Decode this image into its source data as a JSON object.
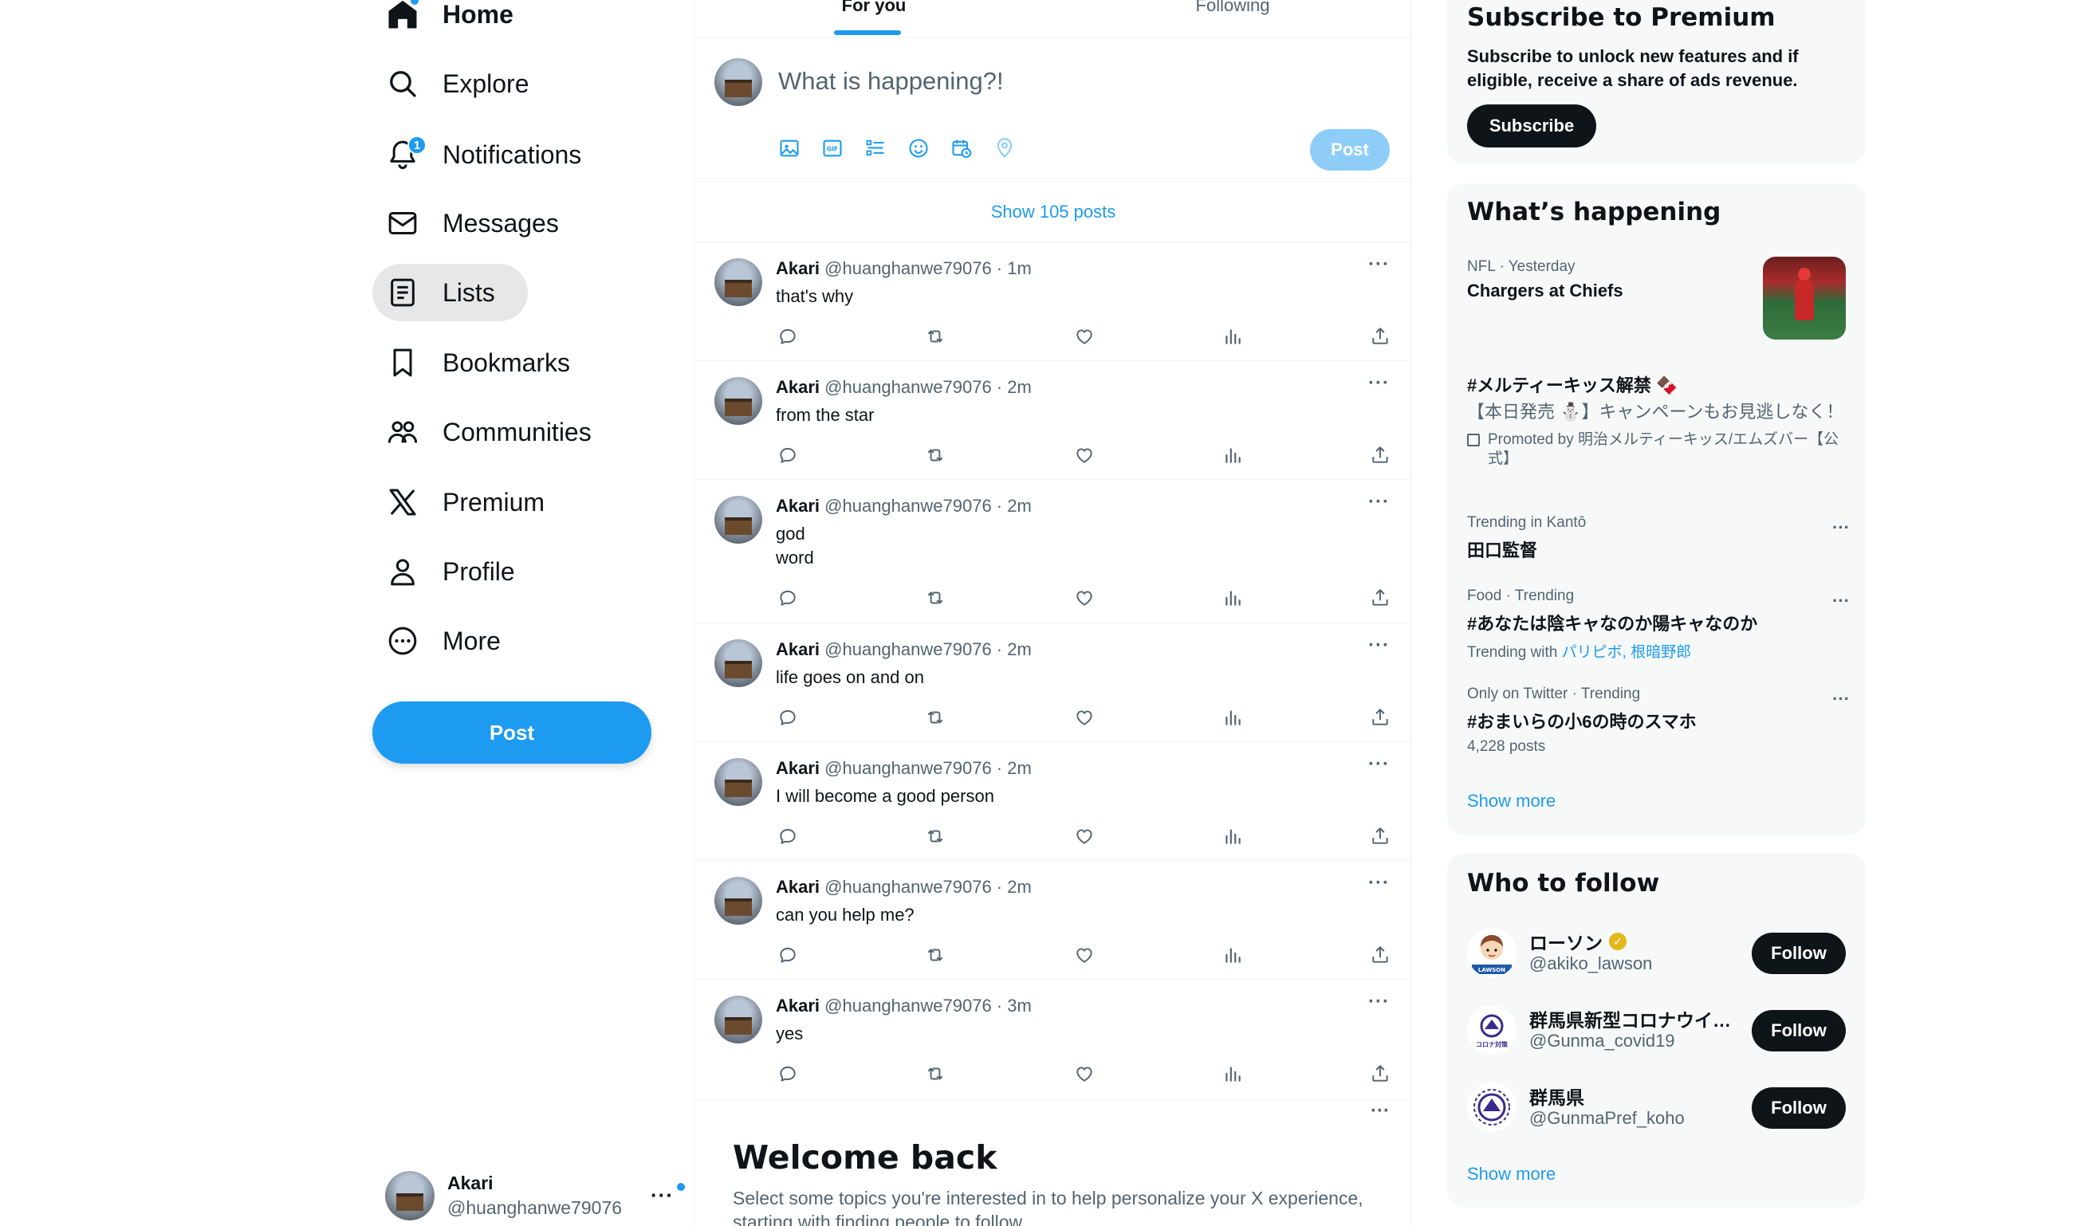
{
  "nav": {
    "items": [
      {
        "label": "Home",
        "icon": "home-icon"
      },
      {
        "label": "Explore",
        "icon": "search-icon"
      },
      {
        "label": "Notifications",
        "icon": "bell-icon",
        "badge": "1"
      },
      {
        "label": "Messages",
        "icon": "envelope-icon"
      },
      {
        "label": "Lists",
        "icon": "list-icon"
      },
      {
        "label": "Bookmarks",
        "icon": "bookmark-icon"
      },
      {
        "label": "Communities",
        "icon": "people-icon"
      },
      {
        "label": "Premium",
        "icon": "x-logo-icon"
      },
      {
        "label": "Profile",
        "icon": "person-icon"
      },
      {
        "label": "More",
        "icon": "more-circle-icon"
      }
    ],
    "post_label": "Post"
  },
  "account": {
    "name": "Akari",
    "handle": "@huanghanwe79076"
  },
  "tabs": [
    {
      "label": "For you"
    },
    {
      "label": "Following"
    }
  ],
  "composer": {
    "placeholder": "What is happening?!",
    "post_label": "Post"
  },
  "show_posts": "Show 105 posts",
  "tweets": [
    {
      "name": "Akari",
      "meta": "@huanghanwe79076 · 1m",
      "text": "that's why"
    },
    {
      "name": "Akari",
      "meta": "@huanghanwe79076 · 2m",
      "text": "from the star"
    },
    {
      "name": "Akari",
      "meta": "@huanghanwe79076 · 2m",
      "text": "god\nword"
    },
    {
      "name": "Akari",
      "meta": "@huanghanwe79076 · 2m",
      "text": "life goes on and on"
    },
    {
      "name": "Akari",
      "meta": "@huanghanwe79076 · 2m",
      "text": "I will become a good person"
    },
    {
      "name": "Akari",
      "meta": "@huanghanwe79076 · 2m",
      "text": "can you help me?"
    },
    {
      "name": "Akari",
      "meta": "@huanghanwe79076 · 3m",
      "text": "yes"
    }
  ],
  "welcome": {
    "title": "Welcome back",
    "text": "Select some topics you're interested in to help personalize your X experience, starting with finding people to follow."
  },
  "premium": {
    "title": "Subscribe to Premium",
    "text": "Subscribe to unlock new features and if eligible, receive a share of ads revenue.",
    "button": "Subscribe"
  },
  "trends": {
    "title": "What’s happening",
    "items": [
      {
        "meta": "NFL · Yesterday",
        "title": "Chargers at Chiefs"
      },
      {
        "title": "#メルティーキッス解禁 🍫",
        "body": "【本日発売 ⛄】キャンペーンもお見逃しなく！",
        "promoted_by": "Promoted by 明治メルティーキッス/エムズバー【公式】"
      },
      {
        "meta": "Trending in Kantō",
        "title": "田口監督"
      },
      {
        "meta": "Food · Trending",
        "title": "#あなたは陰キャなのか陽キャなのか",
        "sub_prefix": "Trending with ",
        "sub_link": "パリピボ, 根暗野郎"
      },
      {
        "meta": "Only on Twitter · Trending",
        "title": "#おまいらの小6の時のスマホ",
        "sub": "4,228 posts"
      }
    ],
    "show_more": "Show more"
  },
  "who_to_follow": {
    "title": "Who to follow",
    "items": [
      {
        "name": "ローソン",
        "handle": "@akiko_lawson",
        "verified": true,
        "button": "Follow"
      },
      {
        "name": "群馬県新型コロナウイ…",
        "handle": "@Gunma_covid19",
        "button": "Follow"
      },
      {
        "name": "群馬県",
        "handle": "@GunmaPref_koho",
        "button": "Follow"
      }
    ],
    "show_more": "Show more"
  },
  "colors": {
    "accent": "#1d9bf0",
    "text": "#0f1419",
    "muted": "#536471",
    "card_bg": "#f7f9f9"
  }
}
